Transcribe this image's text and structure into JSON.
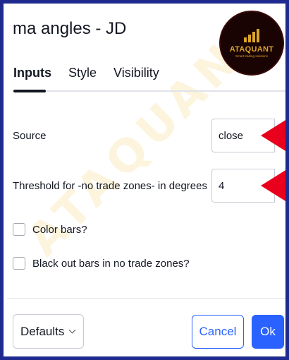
{
  "dialog": {
    "title": "ma angles - JD"
  },
  "logo": {
    "brand": "ATAQUANT",
    "tagline": "Smart trading solutions",
    "color": "#d9a52b",
    "background": "#1a0303"
  },
  "watermark": {
    "text": "ATAQUANT"
  },
  "tabs": [
    {
      "label": "Inputs",
      "active": true
    },
    {
      "label": "Style",
      "active": false
    },
    {
      "label": "Visibility",
      "active": false
    }
  ],
  "inputs": {
    "source": {
      "label": "Source",
      "value": "close"
    },
    "threshold": {
      "label": "Threshold for -no trade zones- in degrees",
      "value": "4"
    },
    "color_bars": {
      "label": "Color bars?",
      "checked": false
    },
    "black_out": {
      "label": "Black out bars in no trade zones?",
      "checked": false
    }
  },
  "annotation": {
    "arrow_color": "#e8001c"
  },
  "footer": {
    "defaults_label": "Defaults",
    "cancel_label": "Cancel",
    "ok_label": "Ok",
    "accent": "#2962ff"
  }
}
